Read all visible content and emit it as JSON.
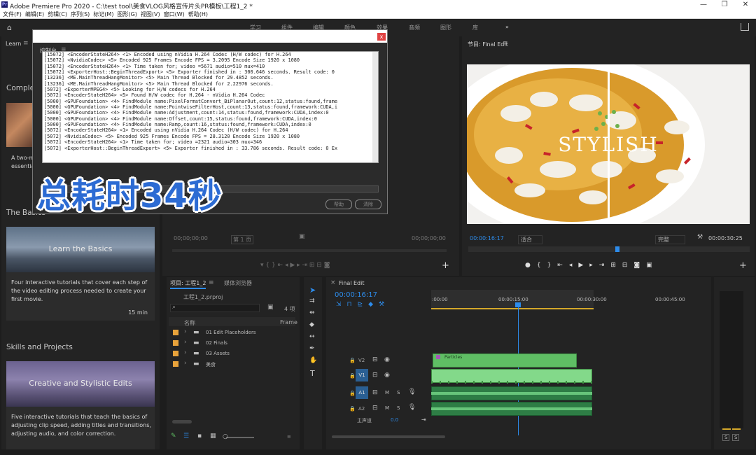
{
  "window": {
    "app_icon": "Pr",
    "title": "Adobe Premiere Pro 2020 - C:\\test tool\\美食VLOG风格宣传片头PR模板\\工程1_2 *",
    "minimize": "—",
    "maximize": "❐",
    "close": "✕"
  },
  "menu": [
    "文件(F)",
    "编辑(E)",
    "剪辑(C)",
    "序列(S)",
    "标记(M)",
    "图形(G)",
    "视图(V)",
    "窗口(W)",
    "帮助(H)"
  ],
  "workspaces": [
    "学习",
    "组件",
    "编辑",
    "颜色",
    "效果",
    "音频",
    "图形",
    "库"
  ],
  "workspace_more": "»",
  "learn": {
    "tab": "Learn",
    "complete_heading": "Comple",
    "first_card_desc": "A two-m\nessentia",
    "basics_heading": "The Basics",
    "card1": {
      "title": "Learn the Basics",
      "desc": "Four interactive tutorials that cover each step of the video editing process needed to create your first movie.",
      "duration": "15 min"
    },
    "skills_heading": "Skills and Projects",
    "card2": {
      "title": "Creative and Stylistic Edits",
      "desc": "Five interactive tutorials that teach the basics of adjusting clip speed, adding titles and transitions, adjusting audio, and color correction."
    }
  },
  "dialog": {
    "tab": "控制台",
    "close": "x",
    "lines": [
      "[15072] <EncoderStateH264> <1> Encoded using nVidia H.264 Codec (H/W codec) for H.264",
      "[15072] <NvidiaCodec> <5> Encoded 925 Frames Encode FPS = 3.2095 Encode Size 1920 x 1080",
      "[15072] <EncoderStateH264> <1> Time taken for; video =5671 audio=510 mux=410",
      "[15072] <ExporterHost::BeginThreadExport> <5> Exporter finished in : 300.646 seconds. Result code: 0",
      "[13236] <ME.MainThreadHangMonitor> <5> Main Thread Blocked for 29.4852 seconds.",
      "[13236] <ME.MainThreadHangMonitor> <5> Main Thread Blocked for 2.22976 seconds.",
      "[5072] <ExporterMPEG4> <5> Looking for H/W codecs for H.264",
      "[5072] <EncoderStateH264> <5> Found H/W codec for H.264 - nVidia H.264 Codec",
      "[5000] <GPUFoundation> <4> FindModule name:PixelFormatConvert_BiPlanarOut,count:12,status:found,frame",
      "[5000] <GPUFoundation> <4> FindModule name:PointwiseFilterHost,count:13,status:found,framework:CUDA,i",
      "[5000] <GPUFoundation> <4> FindModule name:Adjustment,count:14,status:found,framework:CUDA,index:0",
      "[5000] <GPUFoundation> <4> FindModule name:Offset,count:15,status:found,framework:CUDA,index:0",
      "[5000] <GPUFoundation> <4> FindModule name:Ramp,count:16,status:found,framework:CUDA,index:0",
      "[5072] <EncoderStateH264> <1> Encoded using nVidia H.264 Codec (H/W codec) for H.264",
      "[5072] <NvidiaCodec> <5> Encoded 925 Frames Encode FPS = 28.3120 Encode Size 1920 x 1080",
      "[5072] <EncoderStateH264> <1> Time taken for; video =2321 audio=303 mux=346",
      "[5072] <ExporterHost::BeginThreadExport> <5> Exporter finished in : 33.786 seconds. Result code: 0 Ex"
    ],
    "caption": "总耗时34秒",
    "help": "帮助",
    "clear": "清除"
  },
  "source": {
    "tc_left": "00;00;00;00",
    "page": "第 1 页",
    "tc_right": "00;00;00;00"
  },
  "program": {
    "tab": "节目: Final Edit",
    "overlay_text": "STYLISH",
    "tc_left": "00:00:16:17",
    "fit": "适合",
    "quality": "完整",
    "tc_right": "00:00:30:25"
  },
  "project": {
    "tab1": "项目: 工程1_2",
    "tab2": "媒体浏览器",
    "file": "工程1_2.prproj",
    "count": "4 项",
    "col_name": "名称",
    "col_frame": "Frame",
    "items": [
      "01 Edit Placeholders",
      "02 Finals",
      "03 Assets",
      "美食"
    ],
    "accent": "#e8a33b"
  },
  "timeline": {
    "tab": "Final Edit",
    "timecode": "00:00:16:17",
    "ruler": [
      ":00:00",
      "00:00:15:00",
      "00:00:30:00",
      "00:00:45:00"
    ],
    "tracks": [
      "V2",
      "V1",
      "A1",
      "A2"
    ],
    "master": "主声道",
    "master_val": "0.0",
    "clip_label": "Particles",
    "clip_color": "#5fbe64"
  },
  "meter": {
    "labels": [
      "S",
      "S"
    ]
  }
}
